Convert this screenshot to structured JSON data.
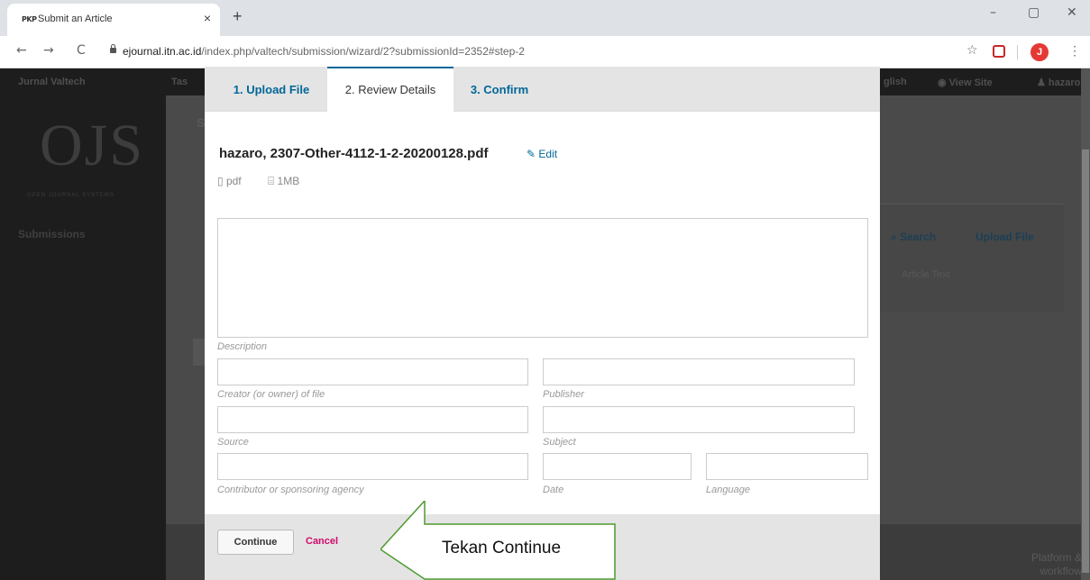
{
  "browser": {
    "tab_favicon": "PKP",
    "tab_title": "Submit an Article",
    "tab_close": "×",
    "new_tab": "+",
    "back": "←",
    "forward": "→",
    "reload": "C",
    "url_host": "ejournal.itn.ac.id",
    "url_path": "/index.php/valtech/submission/wizard/2?submissionId=2352#step-2",
    "profile_initial": "J",
    "star": "☆",
    "menu": "⋮",
    "minimize": "–",
    "restore": "▢",
    "close": "✕"
  },
  "background": {
    "journal_name": "Jurnal Valtech",
    "tasks_fragment": "Tas",
    "lang_fragment": "glish",
    "view_site": "View Site",
    "user_fragment": "hazaro",
    "logo_text": "OJS",
    "logo_sub": "OPEN JOURNAL SYSTEMS",
    "nav_submissions": "Submissions",
    "search_label": "Search",
    "upload_file_label": "Upload File",
    "article_text_label": "Article Text",
    "s_fragment": "S",
    "footer_text": "Platform & workflow by"
  },
  "wizard": {
    "tabs": [
      {
        "label": "1. Upload File"
      },
      {
        "label": "2. Review Details"
      },
      {
        "label": "3. Confirm"
      }
    ],
    "file_name": "hazaro, 2307-Other-4112-1-2-20200128.pdf",
    "edit_label": "Edit",
    "file_type": "pdf",
    "file_size": "1MB",
    "fields": {
      "description": "Description",
      "creator": "Creator (or owner) of file",
      "publisher": "Publisher",
      "source": "Source",
      "subject": "Subject",
      "contributor": "Contributor or sponsoring agency",
      "date": "Date",
      "language": "Language"
    },
    "continue_label": "Continue",
    "cancel_label": "Cancel"
  },
  "annotation": {
    "text": "Tekan Continue"
  }
}
